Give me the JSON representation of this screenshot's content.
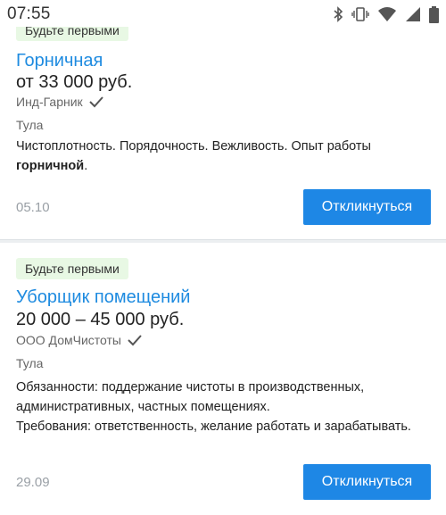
{
  "status_bar": {
    "time": "07:55",
    "icons": [
      "bluetooth-icon",
      "vibrate-icon",
      "wifi-icon",
      "signal-icon",
      "battery-icon"
    ]
  },
  "colors": {
    "title": "#1e8be0",
    "button": "#1e87e5",
    "badge_bg": "#e8f8e4",
    "muted": "#9aa0a6"
  },
  "vacancies": [
    {
      "badge": "Будьте первыми",
      "title": "Горничная",
      "salary": "от 33 000 руб.",
      "company": "Инд-Гарник",
      "city": "Тула",
      "description_prefix": "Чистоплотность. Порядочность. Вежливость. Опыт работы ",
      "description_bold": "горничной",
      "description_suffix": ".",
      "date": "05.10",
      "apply_label": "Откликнуться"
    },
    {
      "badge": "Будьте первыми",
      "title": "Уборщик помещений",
      "salary": "20 000 – 45 000 руб.",
      "company": "ООО ДомЧистоты",
      "city": "Тула",
      "description_line1": "Обязанности: поддержание чистоты в производственных, административных, частных помещениях.",
      "description_line2": "Требования: ответственность, желание работать и зарабатывать.",
      "date": "29.09",
      "apply_label": "Откликнуться"
    }
  ]
}
